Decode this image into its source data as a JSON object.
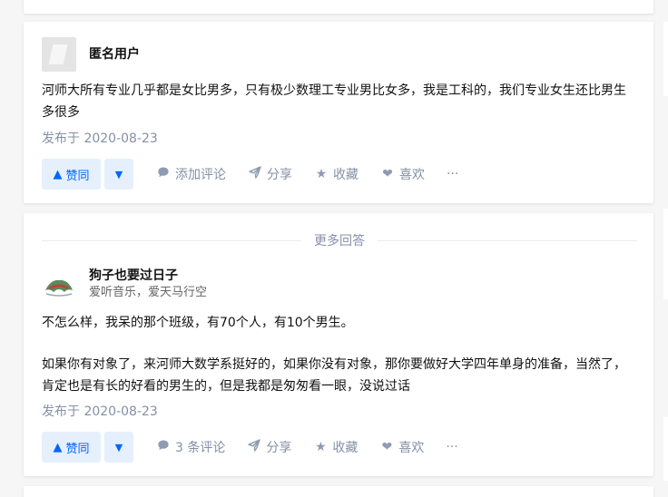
{
  "answers": [
    {
      "author_name": "匿名用户",
      "author_bio": "",
      "paragraphs": [
        "河师大所有专业几乎都是女比男多，只有极少数理工专业男比女多，我是工科的，我们专业女生还比男生多很多"
      ],
      "date": "发布于 2020-08-23",
      "actions": {
        "upvote": "赞同",
        "comment": "添加评论",
        "share": "分享",
        "collect": "收藏",
        "like": "喜欢",
        "more": "···"
      }
    },
    {
      "author_name": "狗子也要过日子",
      "author_bio": "爱听音乐，爱天马行空",
      "paragraphs": [
        "不怎么样，我呆的那个班级，有70个人，有10个男生。",
        "如果你有对象了，来河师大数学系挺好的，如果你没有对象，那你要做好大学四年单身的准备，当然了，肯定也是有长的好看的男生的，但是我都是匆匆看一眼，没说过话"
      ],
      "date": "发布于 2020-08-23",
      "actions": {
        "upvote": "赞同",
        "comment": "3 条评论",
        "share": "分享",
        "collect": "收藏",
        "like": "喜欢",
        "more": "···"
      }
    }
  ],
  "divider_label": "更多回答",
  "icons": {
    "upvote": "triangle-up-icon",
    "downvote": "triangle-down-icon",
    "comment": "speech-bubble-icon",
    "share": "paper-plane-icon",
    "collect": "star-icon",
    "like": "heart-icon"
  },
  "colors": {
    "accent": "#0066ff",
    "accent_bg": "#e5f0fc",
    "muted": "#8590a6"
  }
}
